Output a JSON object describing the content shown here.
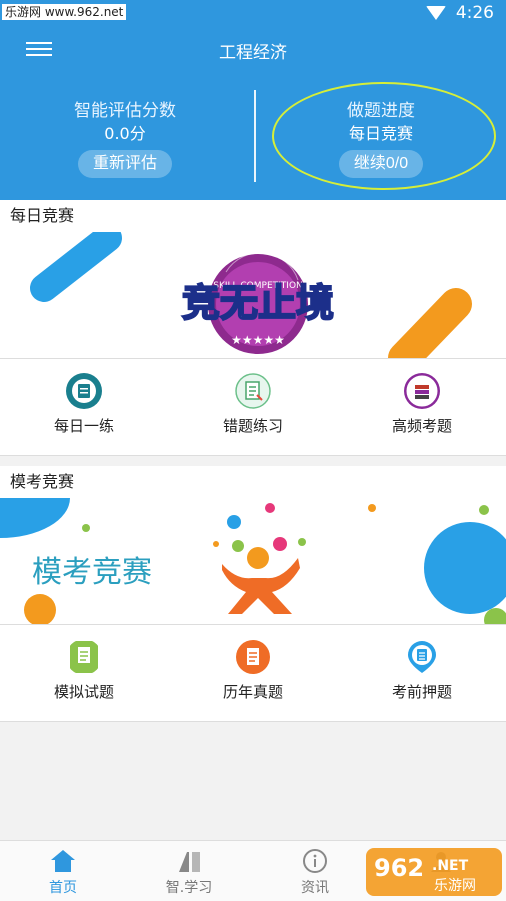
{
  "status_bar": {
    "watermark": "乐游网 www.962.net",
    "time": "4:26"
  },
  "header": {
    "title": "工程经济",
    "left_stat": {
      "label": "智能评估分数",
      "value": "0.0分",
      "button": "重新评估"
    },
    "right_stat": {
      "label": "做题进度",
      "value": "每日竞赛",
      "button": "继续0/0"
    }
  },
  "daily": {
    "title": "每日竞赛",
    "banner_text": "竞无止境",
    "banner_badge": "SKILL COMPETITION",
    "items": [
      {
        "label": "每日一练",
        "icon": "document-icon"
      },
      {
        "label": "错题练习",
        "icon": "wrong-answer-icon"
      },
      {
        "label": "高频考题",
        "icon": "stack-icon"
      }
    ]
  },
  "mock": {
    "title": "模考竞赛",
    "banner_text": "模考竞赛",
    "items": [
      {
        "label": "模拟试题",
        "icon": "paper-icon"
      },
      {
        "label": "历年真题",
        "icon": "exam-icon"
      },
      {
        "label": "考前押题",
        "icon": "pin-list-icon"
      }
    ]
  },
  "bottom_nav": [
    {
      "label": "首页",
      "icon": "home-icon"
    },
    {
      "label": "智.学习",
      "icon": "study-icon"
    },
    {
      "label": "资讯",
      "icon": "info-icon"
    },
    {
      "label": "",
      "icon": "profile-icon"
    }
  ],
  "watermark_logo": {
    "number": "962",
    "suffix": ".NET",
    "name": "乐游网"
  },
  "colors": {
    "primary": "#2f97de",
    "accent_orange": "#f39a1e",
    "highlight": "#d6ee38"
  }
}
